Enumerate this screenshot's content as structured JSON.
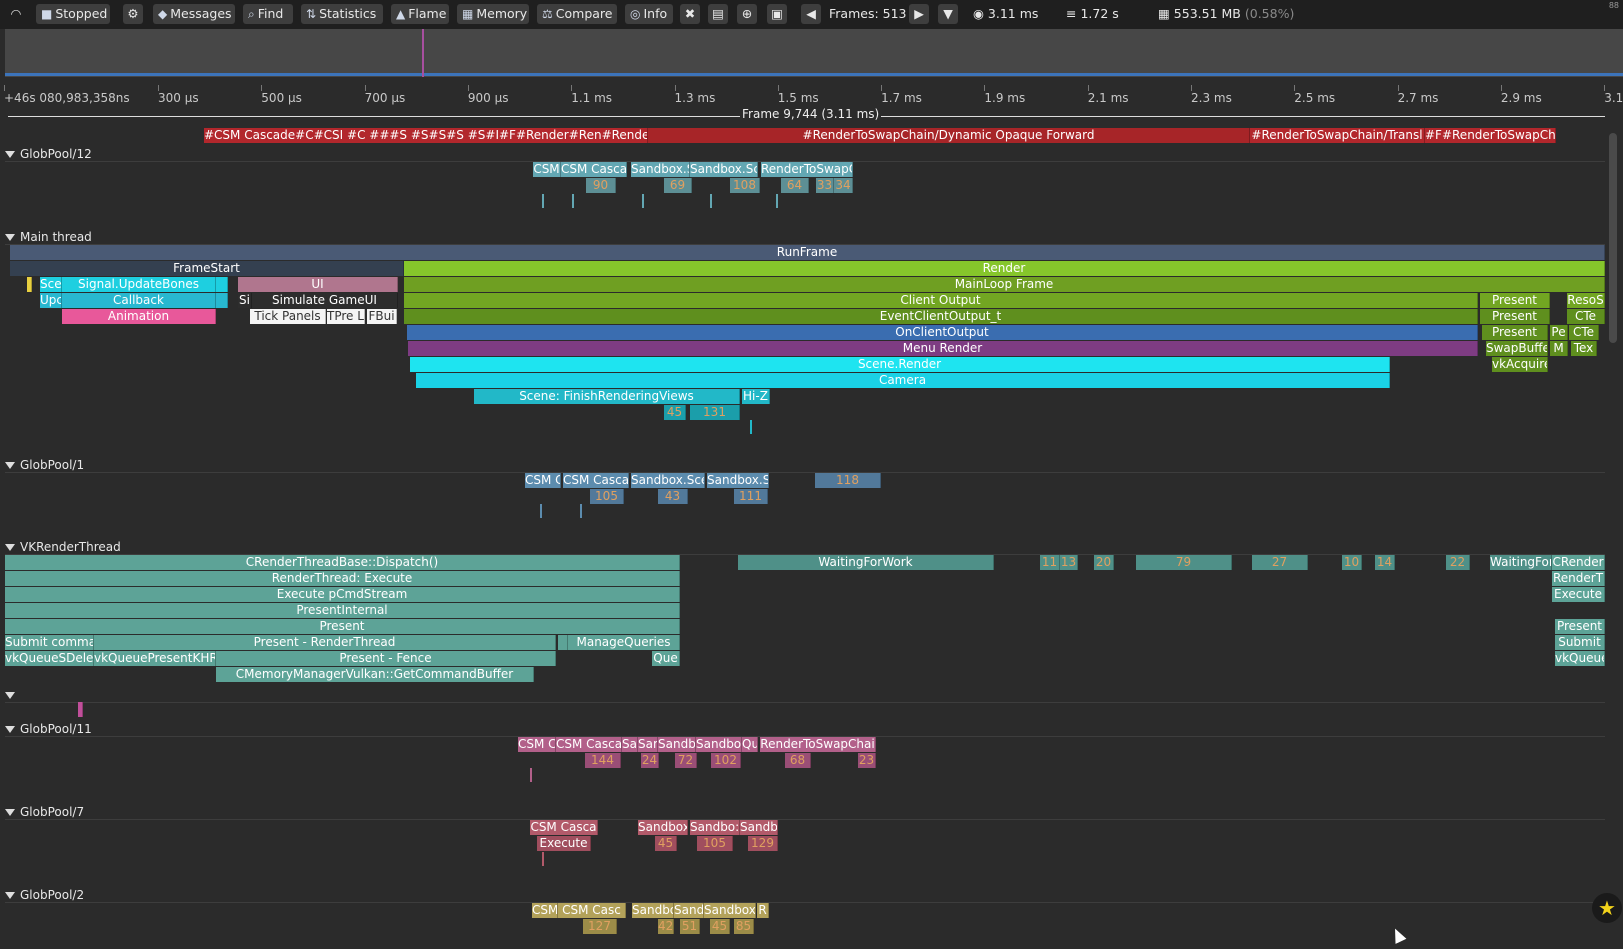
{
  "toolbar": {
    "stopped": "Stopped",
    "messages": "Messages",
    "find": "Find",
    "statistics": "Statistics",
    "flame": "Flame",
    "memory": "Memory",
    "compare": "Compare",
    "info": "Info",
    "frames": "Frames: 513",
    "frame_time": "3.11 ms",
    "total_time": "1.72 s",
    "memory_usage": "553.51 MB",
    "memory_pct": "(0.58%)",
    "corner": "88"
  },
  "ruler": {
    "labels": [
      "+46s 080,983,358ns",
      "300 µs",
      "500 µs",
      "700 µs",
      "900 µs",
      "1.1 ms",
      "1.3 ms",
      "1.5 ms",
      "1.7 ms",
      "1.9 ms",
      "2.1 ms",
      "2.3 ms",
      "2.5 ms",
      "2.7 ms",
      "2.9 ms",
      "3.1"
    ],
    "frame_label": "Frame 9,744 (3.11 ms)"
  },
  "threads": {
    "globpool12": "GlobPool/12",
    "main": "Main thread",
    "globpool1": "GlobPool/1",
    "vkrender": "VKRenderThread",
    "globpool11": "GlobPool/11",
    "globpool7": "GlobPool/7",
    "globpool2": "GlobPool/2"
  },
  "zones": {
    "top_bar": [
      "#CSM Cascade#C",
      "#CSI",
      "#C ###S",
      "#S#S#S",
      "#S#I#F#Render#Ren",
      "#RenderToS",
      "#RenderToSwapChain/Dynamic Opaque Forward",
      "#RenderToSwapChain/Transl",
      "#F#RenderToSwapCh"
    ],
    "gp12": [
      "CSM",
      "CSM Casca",
      "Sandbox.S",
      "Sandbox.Sc",
      "RenderToSwapC",
      "90",
      "69",
      "108",
      "64",
      "33",
      "34"
    ],
    "main": {
      "runframe": "RunFrame",
      "framestart": "FrameStart",
      "render": "Render",
      "mainloop": "MainLoop Frame",
      "signal": "Signal.UpdateBones",
      "sce": "Sce",
      "ui": "UI",
      "client_output": "Client Output",
      "present1": "Present",
      "resc": "ResoS",
      "callback": "Callback",
      "upc": "Upc",
      "simulate": "Simulate GameUI",
      "si": "Si",
      "event_client": "EventClientOutput_t",
      "present2": "Present",
      "cte1": "CTe",
      "animation": "Animation",
      "tick_panels": "Tick Panels",
      "tpre": "TPre L",
      "fbui": "FBui",
      "on_client": "OnClientOutput",
      "present3": "Present",
      "pei": "Pe",
      "cte2": "CTe",
      "menu_render": "Menu Render",
      "swapbuff": "SwapBuffe",
      "m": "M",
      "tex": "Tex",
      "scene_render": "Scene.Render",
      "vkacquire": "vkAcquire",
      "camera": "Camera",
      "finish_views": "Scene: FinishRenderingViews",
      "hiz": "Hi-Z",
      "n45": "45",
      "n131": "131"
    },
    "gp1": [
      "CSM C",
      "CSM Casca",
      "Sandbox.Sce",
      "Sandbox.S",
      "118",
      "105",
      "43",
      "111"
    ],
    "vk": {
      "dispatch": "CRenderThreadBase::Dispatch()",
      "waiting": "WaitingForWork",
      "waiting2": "WaitingFor",
      "crender": "CRender",
      "rt_execute": "RenderThread: Execute",
      "render_t": "RenderT",
      "exec_cmd": "Execute pCmdStream",
      "exec2": "Execute",
      "present_internal": "PresentInternal",
      "present": "Present",
      "present_b": "Present",
      "submit_comma": "Submit comma",
      "present_rt": "Present - RenderThread",
      "manage_queries": "ManageQueries",
      "submit": "Submit",
      "vkqueue_del": "vkQueueSDelet",
      "vkqueue_present": "vkQueuePresentKHR",
      "present_fence": "Present - Fence",
      "que": "Que",
      "vkqueue2": "vkQueue",
      "cmem": "CMemoryManagerVulkan::GetCommandBuffer",
      "nums": [
        "11",
        "13",
        "20",
        "79",
        "27",
        "10",
        "14",
        "22"
      ]
    },
    "gp11": [
      "CSM C",
      "CSM Casca",
      "Sa",
      "Sar",
      "Sandb",
      "Sandbo",
      "Qu",
      "RenderToSwapChai",
      "144",
      "24",
      "72",
      "102",
      "68",
      "23"
    ],
    "gp7": [
      "CSM Casca",
      "Execute",
      "Sandbox",
      "Sandbo:",
      "Sandbo",
      "45",
      "105",
      "129"
    ],
    "gp2": [
      "CSM",
      "CSM Casc",
      "Sandbo",
      "Sand",
      "Sandbox.",
      "R",
      "127",
      "42",
      "51",
      "45",
      "85"
    ]
  }
}
